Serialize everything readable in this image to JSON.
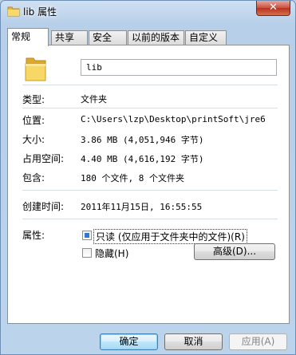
{
  "window": {
    "title": "lib 属性",
    "close_label": "✕"
  },
  "tabs": [
    {
      "label": "常规",
      "active": true
    },
    {
      "label": "共享",
      "active": false
    },
    {
      "label": "安全",
      "active": false
    },
    {
      "label": "以前的版本",
      "active": false
    },
    {
      "label": "自定义",
      "active": false
    }
  ],
  "general": {
    "name_value": "lib",
    "type_label": "类型:",
    "type_value": "文件夹",
    "location_label": "位置:",
    "location_value": "C:\\Users\\lzp\\Desktop\\printSoft\\jre6",
    "size_label": "大小:",
    "size_value": "3.86 MB (4,051,946 字节)",
    "size_on_disk_label": "占用空间:",
    "size_on_disk_value": "4.40 MB (4,616,192 字节)",
    "contains_label": "包含:",
    "contains_value": "180 个文件, 8 个文件夹",
    "created_label": "创建时间:",
    "created_value": "2011年11月15日, 16:55:55",
    "attributes_label": "属性:",
    "readonly_label": "只读 (仅应用于文件夹中的文件)(R)",
    "hidden_label": "隐藏(H)",
    "advanced_button": "高级(D)..."
  },
  "footer": {
    "ok_button": "确定",
    "cancel_button": "取消",
    "apply_button": "应用(A)"
  },
  "colors": {
    "accent": "#2f7ad0",
    "folder": "#f5cf5a"
  },
  "icons": {
    "title": "folder-icon",
    "main": "folder-icon"
  }
}
